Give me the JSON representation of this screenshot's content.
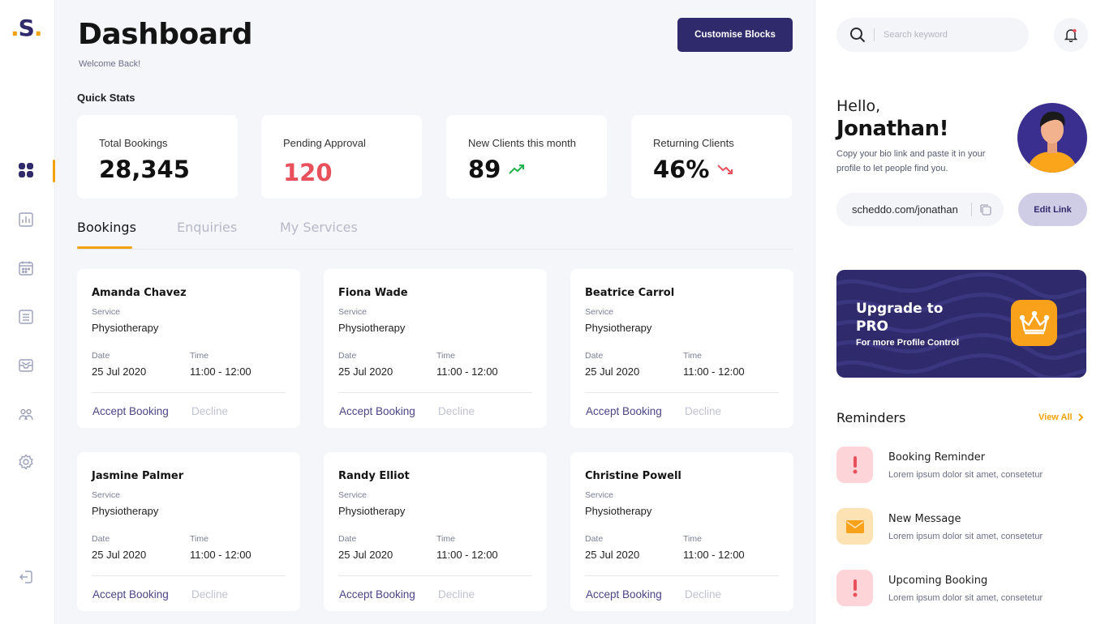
{
  "brand": {
    "logo_text": "S"
  },
  "header": {
    "title": "Dashboard",
    "subtitle": "Welcome Back!",
    "customise_label": "Customise Blocks"
  },
  "quick_stats": {
    "label": "Quick Stats",
    "items": [
      {
        "label": "Total Bookings",
        "value": "28,345"
      },
      {
        "label": "Pending Approval",
        "value": "120"
      },
      {
        "label": "New Clients this month",
        "value": "89",
        "trend": "up"
      },
      {
        "label": "Returning Clients",
        "value": "46%",
        "trend": "down"
      }
    ]
  },
  "tabs": [
    {
      "label": "Bookings",
      "active": true
    },
    {
      "label": "Enquiries",
      "active": false
    },
    {
      "label": "My Services",
      "active": false
    }
  ],
  "booking_labels": {
    "service": "Service",
    "date": "Date",
    "time": "Time",
    "accept": "Accept Booking",
    "decline": "Decline"
  },
  "bookings": [
    {
      "name": "Amanda Chavez",
      "service": "Physiotherapy",
      "date": "25 Jul 2020",
      "time": "11:00 - 12:00"
    },
    {
      "name": "Fiona Wade",
      "service": "Physiotherapy",
      "date": "25 Jul 2020",
      "time": "11:00 - 12:00"
    },
    {
      "name": "Beatrice Carrol",
      "service": "Physiotherapy",
      "date": "25 Jul 2020",
      "time": "11:00 - 12:00"
    },
    {
      "name": "Jasmine Palmer",
      "service": "Physiotherapy",
      "date": "25 Jul 2020",
      "time": "11:00 - 12:00"
    },
    {
      "name": "Randy Elliot",
      "service": "Physiotherapy",
      "date": "25 Jul 2020",
      "time": "11:00 - 12:00"
    },
    {
      "name": "Christine Powell",
      "service": "Physiotherapy",
      "date": "25 Jul 2020",
      "time": "11:00 - 12:00"
    }
  ],
  "search": {
    "placeholder": "Search keyword"
  },
  "profile": {
    "greeting": "Hello,",
    "name": "Jonathan!",
    "description": "Copy your bio link and paste it in your profile to let people find you.",
    "bio_link": "scheddo.com/jonathan",
    "edit_label": "Edit Link"
  },
  "promo": {
    "title": "Upgrade to PRO",
    "subtitle": "For more Profile Control"
  },
  "reminders": {
    "title": "Reminders",
    "view_all": "View All",
    "items": [
      {
        "title": "Booking Reminder",
        "desc": "Lorem ipsum dolor sit amet, consetetur",
        "icon": "alert-icon"
      },
      {
        "title": "New Message",
        "desc": "Lorem ipsum dolor sit amet, consetetur",
        "icon": "envelope-icon"
      },
      {
        "title": "Upcoming Booking",
        "desc": "Lorem ipsum dolor sit amet, consetetur",
        "icon": "alert-icon"
      }
    ]
  },
  "colors": {
    "primary": "#2f2a6b",
    "accent": "#f4a20c",
    "danger": "#e8505b",
    "success": "#22b24c"
  }
}
